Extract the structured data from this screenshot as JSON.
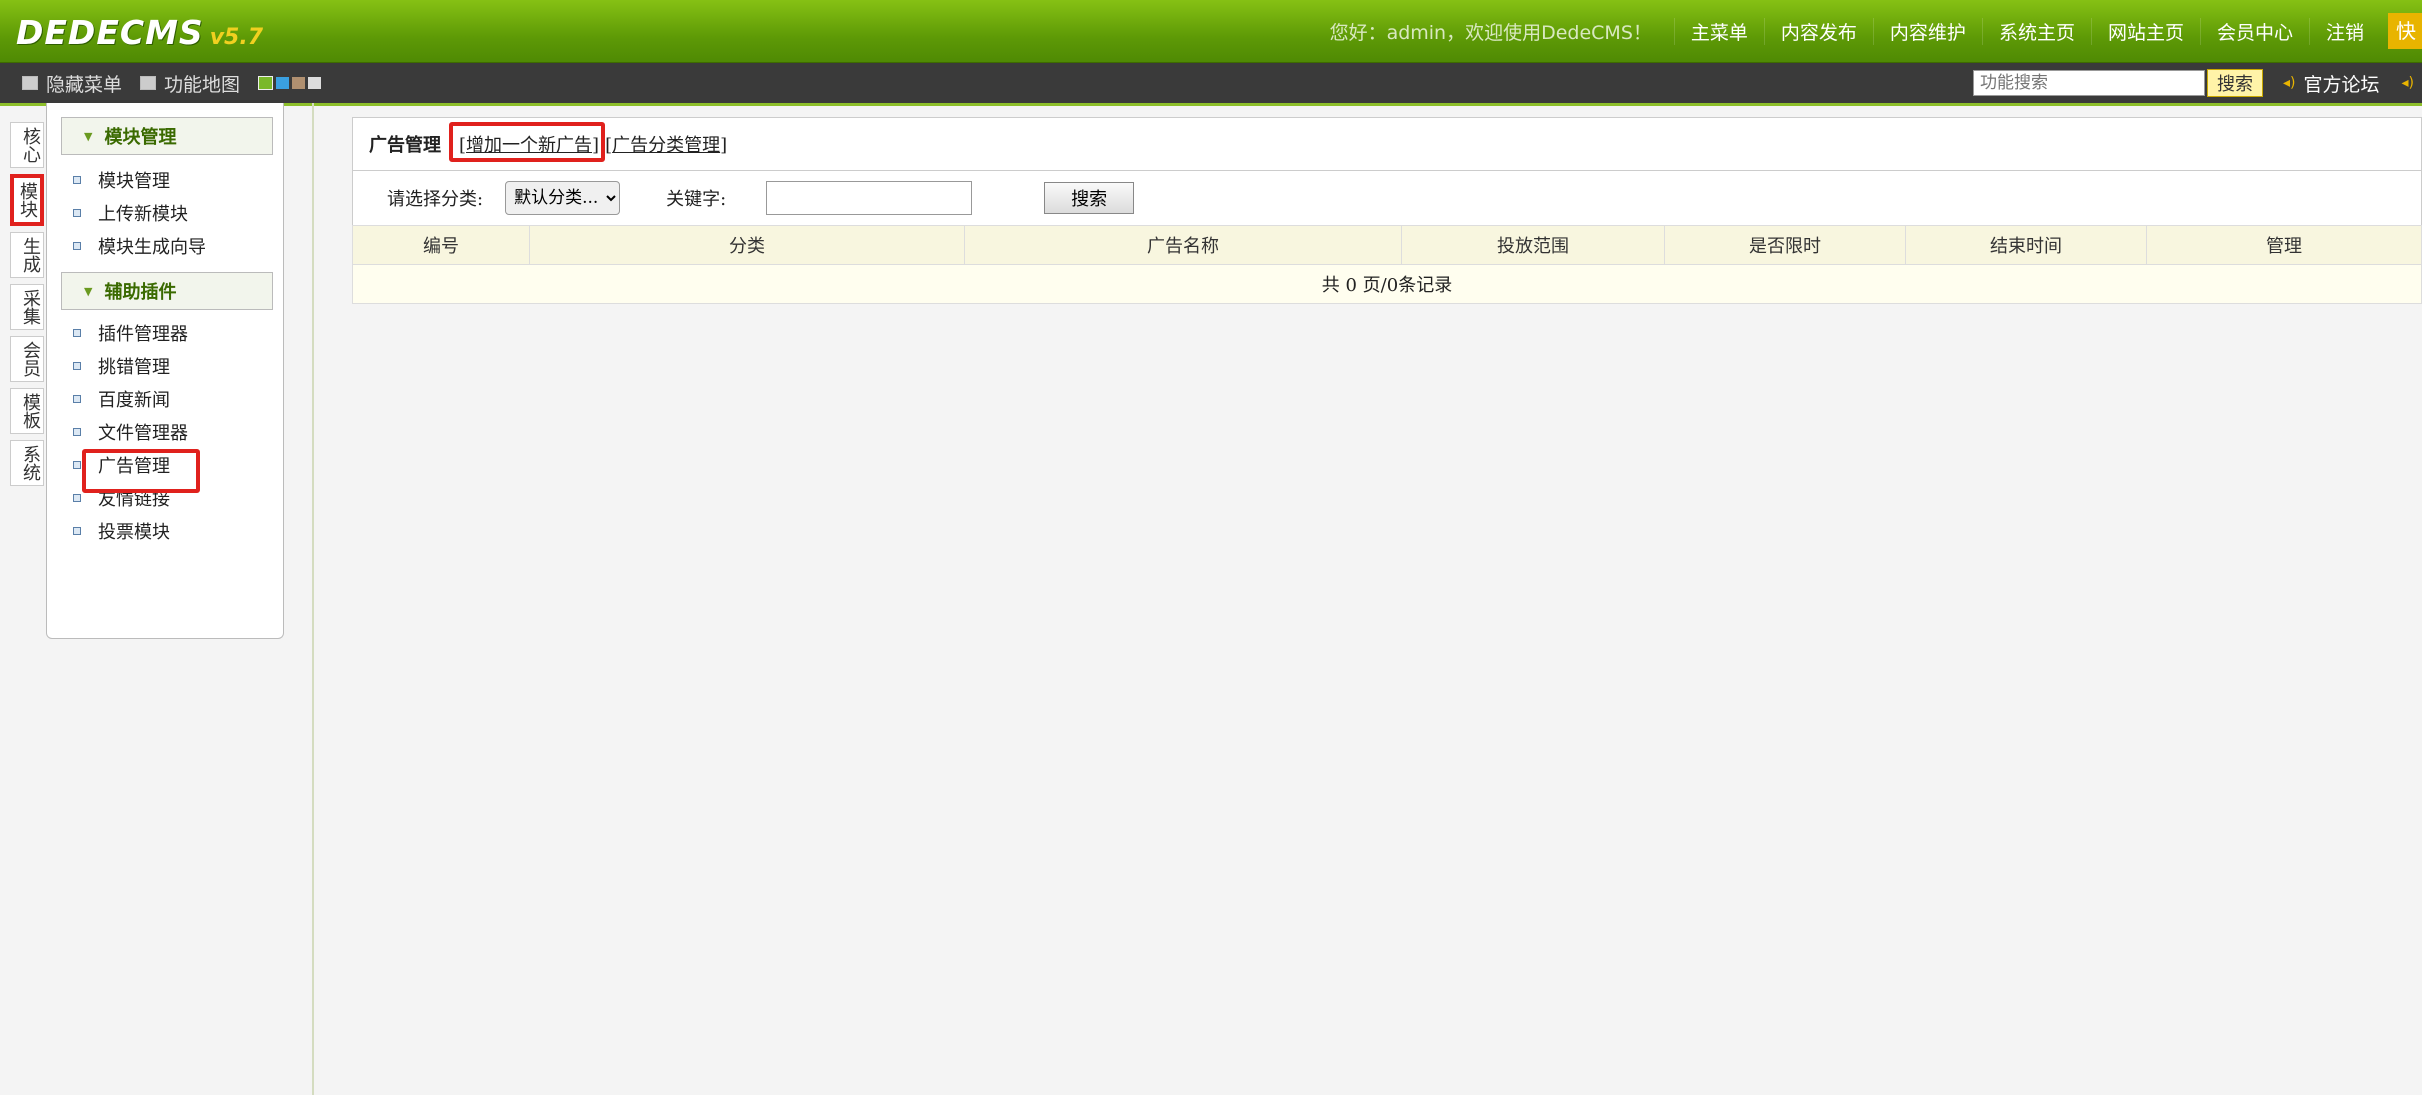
{
  "app": {
    "logo_text": "DEDECMS",
    "version": "v5.7"
  },
  "topnav": {
    "welcome": "您好：admin，欢迎使用DedeCMS！",
    "items": [
      "主菜单",
      "内容发布",
      "内容维护",
      "系统主页",
      "网站主页",
      "会员中心",
      "注销"
    ],
    "quick": "快"
  },
  "bar2": {
    "hide_menu": "隐藏菜单",
    "function_map": "功能地图",
    "skin_colors": [
      "#7ab82a",
      "#3aa0e0",
      "#b09070",
      "#dddddd"
    ],
    "search_placeholder": "功能搜索",
    "search_button": "搜索",
    "forum": "官方论坛"
  },
  "vtabs": [
    {
      "label": "核心",
      "active": false
    },
    {
      "label": "模块",
      "active": true
    },
    {
      "label": "生成",
      "active": false
    },
    {
      "label": "采集",
      "active": false
    },
    {
      "label": "会员",
      "active": false
    },
    {
      "label": "模板",
      "active": false
    },
    {
      "label": "系统",
      "active": false
    }
  ],
  "menu": {
    "groups": [
      {
        "title": "模块管理",
        "items": [
          "模块管理",
          "上传新模块",
          "模块生成向导"
        ]
      },
      {
        "title": "辅助插件",
        "items": [
          "插件管理器",
          "挑错管理",
          "百度新闻",
          "文件管理器",
          "广告管理",
          "友情链接",
          "投票模块"
        ]
      }
    ],
    "highlighted_item": "广告管理"
  },
  "main": {
    "title": "广告管理",
    "link_add": "增加一个新广告",
    "link_category": "广告分类管理",
    "filter": {
      "category_label": "请选择分类:",
      "category_value": "默认分类...",
      "keyword_label": "关键字:",
      "keyword_value": "",
      "search_button": "搜索"
    },
    "table": {
      "columns": [
        "编号",
        "分类",
        "广告名称",
        "投放范围",
        "是否限时",
        "结束时间",
        "管理"
      ],
      "footer": "共 0 页/0条记录"
    }
  },
  "colors": {
    "highlight": "#e0211d",
    "brand_green": "#5e9a06"
  }
}
